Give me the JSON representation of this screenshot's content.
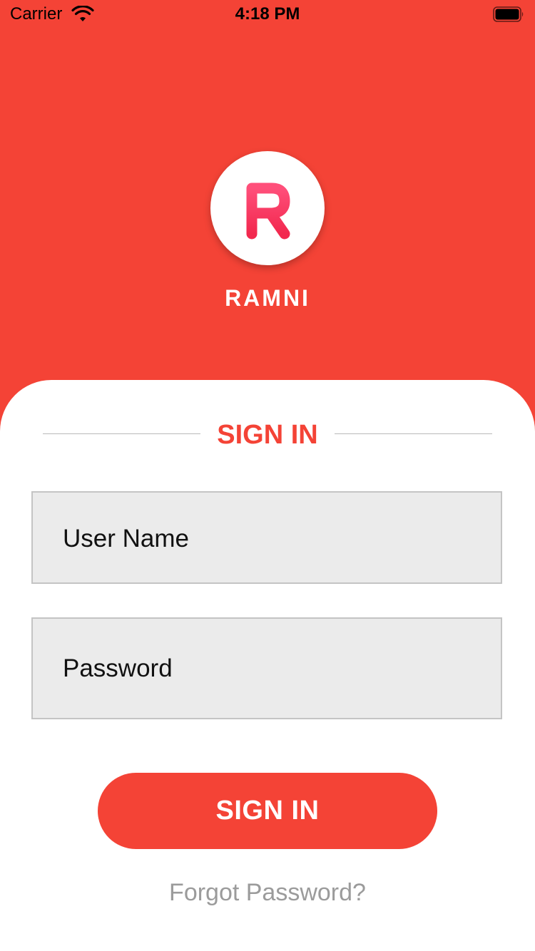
{
  "status_bar": {
    "carrier": "Carrier",
    "time": "4:18 PM"
  },
  "brand": {
    "logo_letter": "R",
    "name": "RAMNI"
  },
  "form": {
    "title": "SIGN IN",
    "username_placeholder": "User Name",
    "password_placeholder": "Password",
    "submit_label": "SIGN IN",
    "forgot_label": "Forgot Password?"
  },
  "colors": {
    "primary": "#f44336",
    "logo_gradient_start": "#ff4f7a",
    "logo_gradient_end": "#f2284e",
    "field_bg": "#ebebeb",
    "muted_text": "#9b9b9b"
  },
  "icons": {
    "wifi": "wifi-icon",
    "battery": "battery-icon"
  }
}
